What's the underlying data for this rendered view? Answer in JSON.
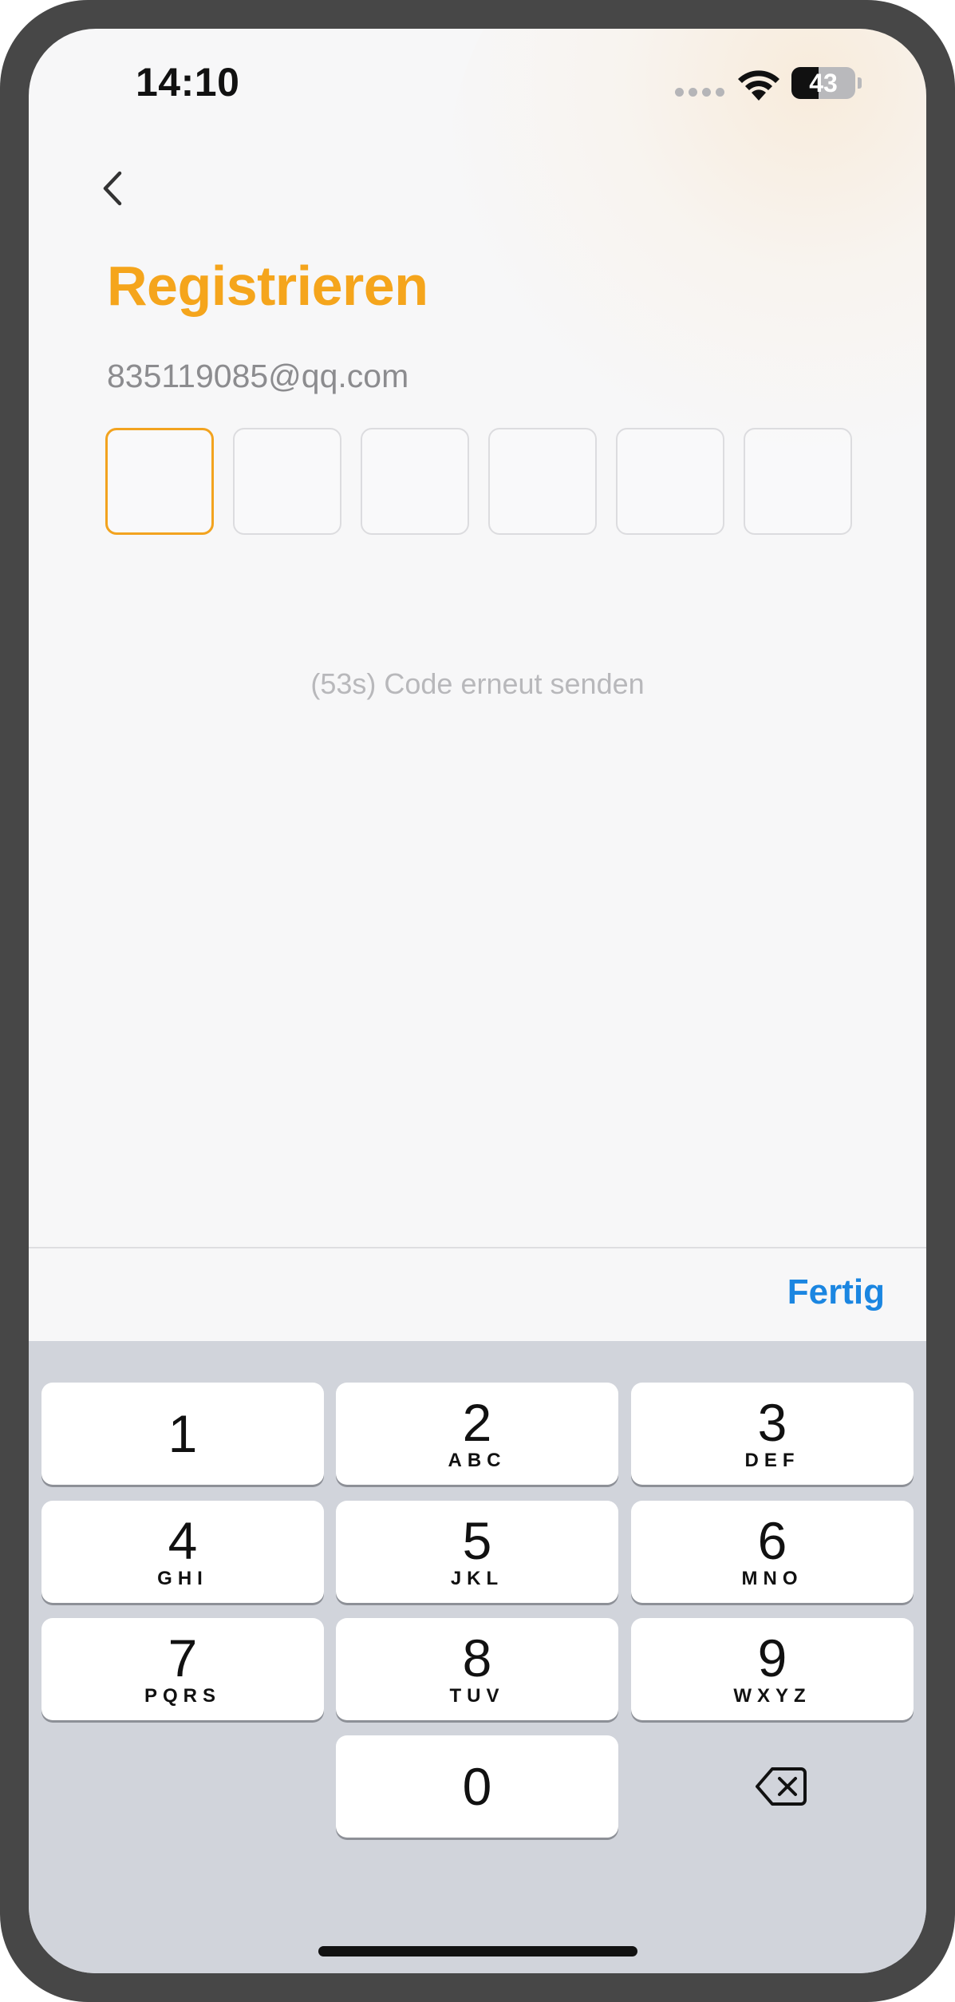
{
  "status_bar": {
    "time": "14:10",
    "battery_level": "43"
  },
  "header": {
    "back_icon": "chevron-left-icon",
    "title": "Registrieren"
  },
  "email": "835119085@qq.com",
  "code_inputs": [
    "",
    "",
    "",
    "",
    "",
    ""
  ],
  "resend_text": "(53s) Code erneut senden",
  "toolbar": {
    "done_label": "Fertig"
  },
  "keyboard": {
    "keys": [
      {
        "digit": "1",
        "letters": ""
      },
      {
        "digit": "2",
        "letters": "ABC"
      },
      {
        "digit": "3",
        "letters": "DEF"
      },
      {
        "digit": "4",
        "letters": "GHI"
      },
      {
        "digit": "5",
        "letters": "JKL"
      },
      {
        "digit": "6",
        "letters": "MNO"
      },
      {
        "digit": "7",
        "letters": "PQRS"
      },
      {
        "digit": "8",
        "letters": "TUV"
      },
      {
        "digit": "9",
        "letters": "WXYZ"
      },
      {
        "digit": "0",
        "letters": ""
      }
    ],
    "delete_icon": "backspace-icon"
  },
  "colors": {
    "accent": "#f5a51c",
    "link": "#1b86e1",
    "keyboard_bg": "#d1d4db"
  }
}
